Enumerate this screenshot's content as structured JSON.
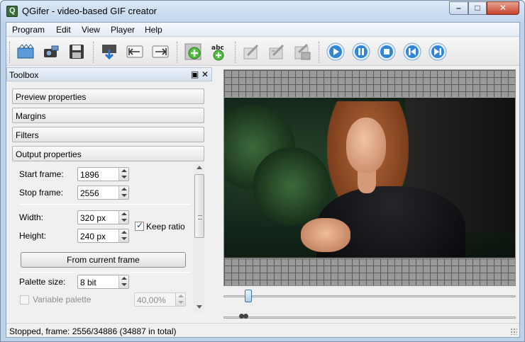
{
  "window": {
    "title": "QGifer - video-based GIF creator",
    "controls": {
      "minimize": "–",
      "maximize": "□",
      "close": "✕"
    }
  },
  "menubar": {
    "items": [
      "Program",
      "Edit",
      "View",
      "Player",
      "Help"
    ]
  },
  "toolbar": {
    "icons": [
      "open-video-icon",
      "render-icon",
      "save-icon",
      "extract-gif-icon",
      "set-start-icon",
      "set-stop-icon",
      "add-object-icon",
      "add-text-icon",
      "edit-object-icon",
      "edit-text-icon",
      "save-as-icon",
      "play-icon",
      "pause-icon",
      "stop-icon",
      "prev-frame-icon",
      "next-frame-icon"
    ]
  },
  "toolbox": {
    "title": "Toolbox",
    "float_glyph": "▣",
    "close_glyph": "✕",
    "sections": [
      "Preview properties",
      "Margins",
      "Filters",
      "Output properties"
    ],
    "output": {
      "start_frame_label": "Start frame:",
      "start_frame_value": "1896",
      "stop_frame_label": "Stop frame:",
      "stop_frame_value": "2556",
      "width_label": "Width:",
      "width_value": "320 px",
      "height_label": "Height:",
      "height_value": "240 px",
      "keep_ratio_label": "Keep ratio",
      "keep_ratio_checked": true,
      "from_current_frame_label": "From current frame",
      "palette_size_label": "Palette size:",
      "palette_size_value": "8 bit",
      "variable_palette_label": "Variable palette",
      "variable_palette_checked": false,
      "variable_palette_value": "40,00%"
    }
  },
  "player": {
    "position_fraction": 0.073
  },
  "status": {
    "text": "Stopped, frame: 2556/34886 (34887 in total)"
  },
  "colors": {
    "accent": "#3a77ad",
    "titlebar": "#c1d5ec",
    "play_button": "#2f86d6"
  }
}
